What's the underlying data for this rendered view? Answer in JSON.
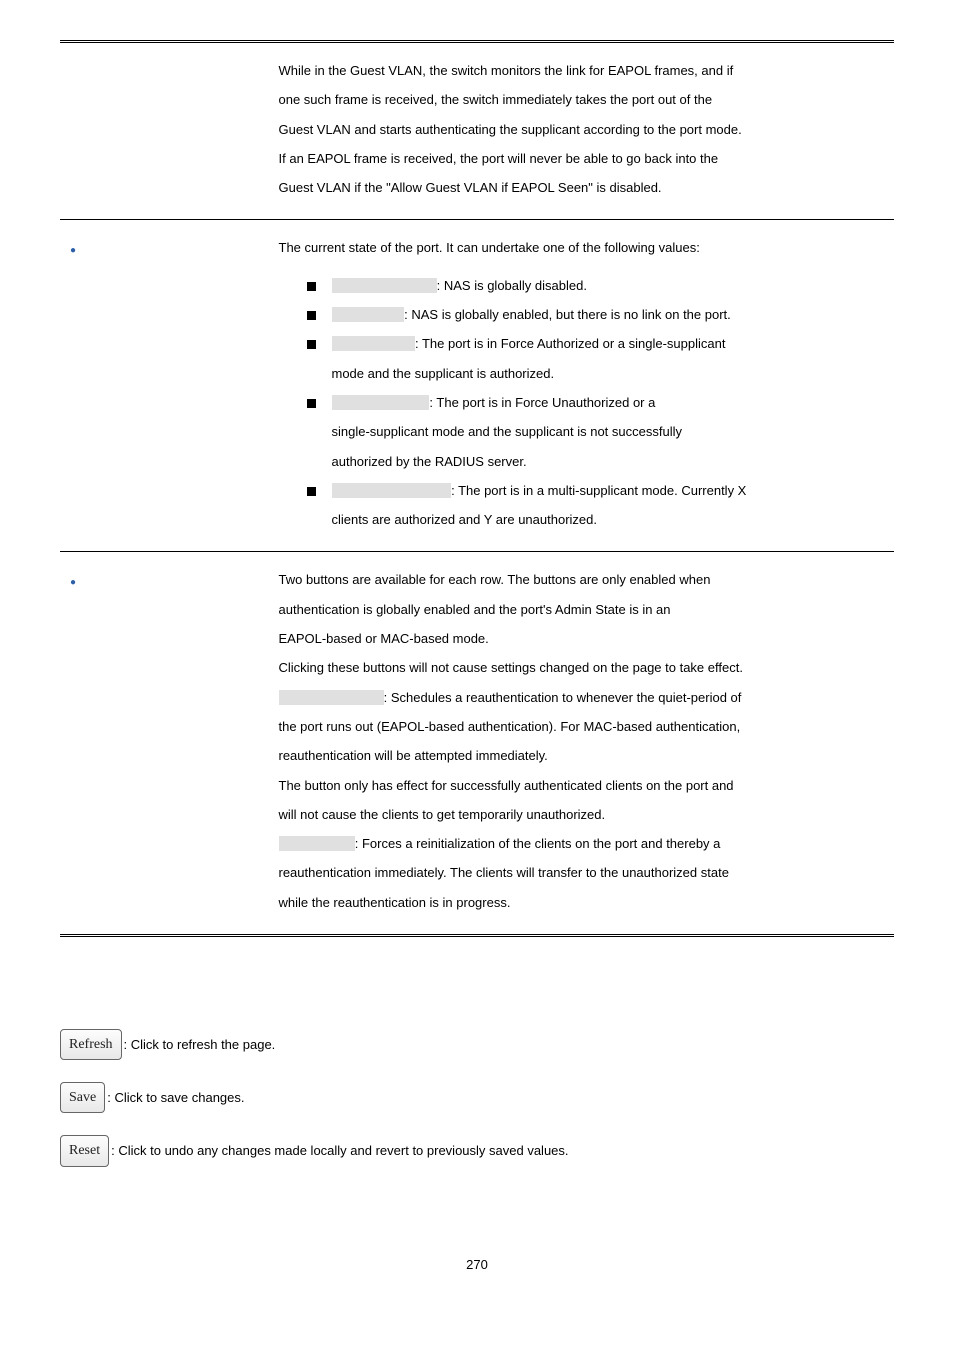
{
  "table": {
    "row1": {
      "p1": "While in the Guest VLAN, the switch monitors the link for EAPOL frames, and if",
      "p2": "one such frame is received, the switch immediately takes the port out of the",
      "p3": "Guest VLAN and starts authenticating the supplicant according to the port mode.",
      "p4": "If an EAPOL frame is received, the port will never be able to go back into the",
      "p5": "Guest VLAN if the \"Allow Guest VLAN if EAPOL Seen\" is disabled."
    },
    "row2": {
      "intro": "The current state of the port. It can undertake one of the following values:",
      "b1_after": ": NAS is globally disabled.",
      "b2_after": ": NAS is globally enabled, but there is no link on the port.",
      "b3_after": ": The port is in Force Authorized or a single-supplicant",
      "b3_cont": "mode and the supplicant is authorized.",
      "b4_after": ": The port is in Force Unauthorized or a",
      "b4_cont1": "single-supplicant mode and the supplicant is not successfully",
      "b4_cont2": "authorized by the RADIUS server.",
      "b5_after": ": The port is in a multi-supplicant mode. Currently X",
      "b5_cont": "clients are authorized and Y are unauthorized."
    },
    "row3": {
      "p1": "Two buttons are available for each row. The buttons are only enabled when",
      "p2": "authentication is globally enabled and the port's Admin State is in an",
      "p3": "EAPOL-based or MAC-based mode.",
      "p4": "Clicking these buttons will not cause settings changed on the page to take effect.",
      "p5_after": ": Schedules a reauthentication to whenever the quiet-period of",
      "p6": "the port runs out (EAPOL-based authentication). For MAC-based authentication,",
      "p7": "reauthentication will be attempted immediately.",
      "p8": "The button only has effect for successfully authenticated clients on the port and",
      "p9": "will not cause the clients to get temporarily unauthorized.",
      "p10_after": ": Forces a reinitialization of the clients on the port and thereby a",
      "p11": "reauthentication immediately. The clients will transfer to the unauthorized state",
      "p12": "while the reauthentication is in progress."
    }
  },
  "buttons": {
    "refresh_label": "Refresh",
    "refresh_text": ": Click to refresh the page.",
    "save_label": "Save",
    "save_text": ": Click to save changes.",
    "reset_label": "Reset",
    "reset_text": ": Click to undo any changes made locally and revert to previously saved values."
  },
  "page_number": "270"
}
